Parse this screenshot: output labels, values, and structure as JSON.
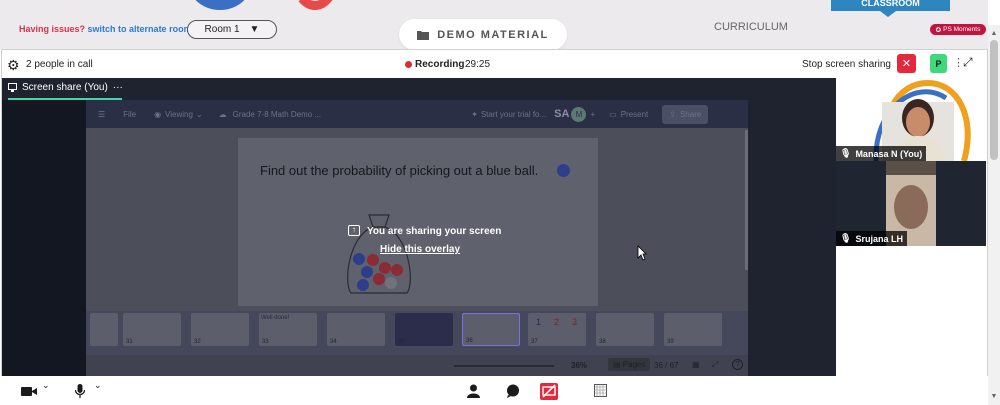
{
  "topbar": {
    "issue_prefix": "Having issues?",
    "issue_link": "switch to alternate room",
    "room_value": "Room 1",
    "demo_label": "DEMO MATERIAL",
    "curriculum_label": "CURRICULUM",
    "classroom_label": "CLASSROOM",
    "moments_label": "PS Moments"
  },
  "call": {
    "people_count_label": "2 people in call",
    "recording_label": "Recording",
    "recording_time": "29:25",
    "stop_sharing_label": "Stop screen sharing",
    "self_avatar_initial": "P"
  },
  "share": {
    "tab_label": "Screen share (You)",
    "toolbar": {
      "file": "File",
      "viewing": "Viewing",
      "doc_title": "Grade 7-8 Math Demo ...",
      "trial": "Start your trial fo...",
      "initials_sa": "SA",
      "initials_m": "M",
      "present": "Present",
      "share": "Share"
    },
    "slide_question": "Find out the probability of picking out a blue ball.",
    "overlay_message": "You are sharing your screen",
    "overlay_hide": "Hide this overlay",
    "thumbnails": [
      {
        "num": "31"
      },
      {
        "num": "32"
      },
      {
        "num": "33",
        "title": "Well done!"
      },
      {
        "num": "34"
      },
      {
        "num": "35"
      },
      {
        "num": "36"
      },
      {
        "num": "37",
        "digits": [
          "1",
          "2",
          "3"
        ]
      },
      {
        "num": "38"
      },
      {
        "num": "39"
      }
    ],
    "status": {
      "zoom": "36%",
      "pages_label": "Pages",
      "page_indicator": "36 / 67",
      "help": "?"
    }
  },
  "participants": [
    {
      "name": "Manasa N (You)"
    },
    {
      "name": "Srujana LH"
    }
  ],
  "colors": {
    "accent_green": "#47d7a6",
    "record_red": "#e12b2b",
    "stop_red": "#e5283b",
    "brand_blue": "#2e86c1",
    "issue_red": "#d6344a"
  }
}
